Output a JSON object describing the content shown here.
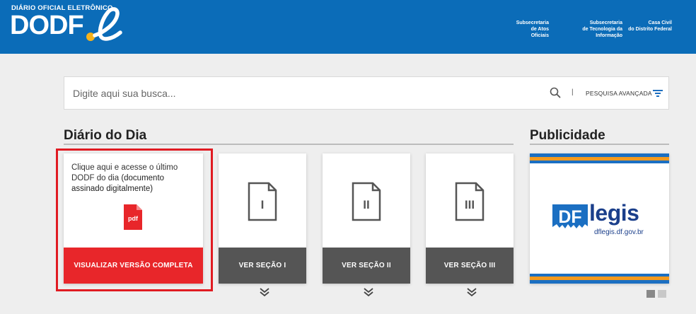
{
  "header": {
    "logo_subtitle": "DIÁRIO OFICIAL ELETRÔNICO",
    "logo_text": "DODF",
    "links": [
      {
        "line1": "Subsecretaria",
        "line2": "de Atos Oficiais"
      },
      {
        "line1": "Subsecretaria",
        "line2": "de Tecnologia da Informação"
      },
      {
        "line1": "Casa Civil",
        "line2": "do Distrito Federal"
      }
    ],
    "colors": {
      "primary": "#0b6cb8",
      "accent": "#f6b21a"
    }
  },
  "search": {
    "placeholder": "Digite aqui sua busca...",
    "value": "",
    "advanced_label": "PESQUISA AVANÇADA",
    "separator": "|",
    "search_icon": "search-icon",
    "filter_icon": "filter-icon"
  },
  "diario": {
    "title": "Diário do Dia",
    "main_card": {
      "text_prefix": "Clique aqui e acesse o último DODF do dia ",
      "text_bold": "(documento assinado digitalmente)",
      "pdf_label": "pdf",
      "button": "VISUALIZAR VERSÃO COMPLETA",
      "button_color": "#e8262a"
    },
    "sections": [
      {
        "numeral": "I",
        "button": "VER SEÇÃO I"
      },
      {
        "numeral": "II",
        "button": "VER SEÇÃO II"
      },
      {
        "numeral": "III",
        "button": "VER SEÇÃO III"
      }
    ]
  },
  "publicidade": {
    "title": "Publicidade",
    "ad": {
      "brand_df": "DF",
      "brand_legis": "legis",
      "url": "dflegis.df.gov.br",
      "colors": {
        "blue": "#1b6fc2",
        "orange": "#f39a1e",
        "navy": "#1b3f8b"
      }
    },
    "carousel_dots": 2
  }
}
